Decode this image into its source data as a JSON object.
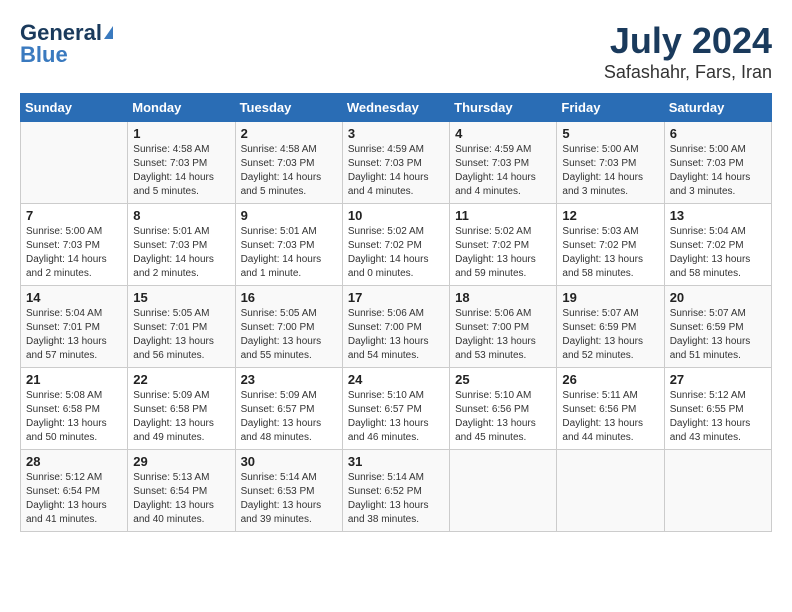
{
  "header": {
    "logo_general": "General",
    "logo_blue": "Blue",
    "title": "July 2024",
    "subtitle": "Safashahr, Fars, Iran"
  },
  "calendar": {
    "days_of_week": [
      "Sunday",
      "Monday",
      "Tuesday",
      "Wednesday",
      "Thursday",
      "Friday",
      "Saturday"
    ],
    "weeks": [
      [
        {
          "day": "",
          "info": ""
        },
        {
          "day": "1",
          "info": "Sunrise: 4:58 AM\nSunset: 7:03 PM\nDaylight: 14 hours\nand 5 minutes."
        },
        {
          "day": "2",
          "info": "Sunrise: 4:58 AM\nSunset: 7:03 PM\nDaylight: 14 hours\nand 5 minutes."
        },
        {
          "day": "3",
          "info": "Sunrise: 4:59 AM\nSunset: 7:03 PM\nDaylight: 14 hours\nand 4 minutes."
        },
        {
          "day": "4",
          "info": "Sunrise: 4:59 AM\nSunset: 7:03 PM\nDaylight: 14 hours\nand 4 minutes."
        },
        {
          "day": "5",
          "info": "Sunrise: 5:00 AM\nSunset: 7:03 PM\nDaylight: 14 hours\nand 3 minutes."
        },
        {
          "day": "6",
          "info": "Sunrise: 5:00 AM\nSunset: 7:03 PM\nDaylight: 14 hours\nand 3 minutes."
        }
      ],
      [
        {
          "day": "7",
          "info": ""
        },
        {
          "day": "8",
          "info": "Sunrise: 5:01 AM\nSunset: 7:03 PM\nDaylight: 14 hours\nand 2 minutes."
        },
        {
          "day": "9",
          "info": "Sunrise: 5:01 AM\nSunset: 7:03 PM\nDaylight: 14 hours\nand 1 minute."
        },
        {
          "day": "10",
          "info": "Sunrise: 5:02 AM\nSunset: 7:02 PM\nDaylight: 14 hours\nand 0 minutes."
        },
        {
          "day": "11",
          "info": "Sunrise: 5:02 AM\nSunset: 7:02 PM\nDaylight: 13 hours\nand 59 minutes."
        },
        {
          "day": "12",
          "info": "Sunrise: 5:03 AM\nSunset: 7:02 PM\nDaylight: 13 hours\nand 58 minutes."
        },
        {
          "day": "13",
          "info": "Sunrise: 5:04 AM\nSunset: 7:02 PM\nDaylight: 13 hours\nand 58 minutes."
        }
      ],
      [
        {
          "day": "14",
          "info": ""
        },
        {
          "day": "15",
          "info": "Sunrise: 5:05 AM\nSunset: 7:01 PM\nDaylight: 13 hours\nand 56 minutes."
        },
        {
          "day": "16",
          "info": "Sunrise: 5:05 AM\nSunset: 7:00 PM\nDaylight: 13 hours\nand 55 minutes."
        },
        {
          "day": "17",
          "info": "Sunrise: 5:06 AM\nSunset: 7:00 PM\nDaylight: 13 hours\nand 54 minutes."
        },
        {
          "day": "18",
          "info": "Sunrise: 5:06 AM\nSunset: 7:00 PM\nDaylight: 13 hours\nand 53 minutes."
        },
        {
          "day": "19",
          "info": "Sunrise: 5:07 AM\nSunset: 6:59 PM\nDaylight: 13 hours\nand 52 minutes."
        },
        {
          "day": "20",
          "info": "Sunrise: 5:07 AM\nSunset: 6:59 PM\nDaylight: 13 hours\nand 51 minutes."
        }
      ],
      [
        {
          "day": "21",
          "info": ""
        },
        {
          "day": "22",
          "info": "Sunrise: 5:09 AM\nSunset: 6:58 PM\nDaylight: 13 hours\nand 49 minutes."
        },
        {
          "day": "23",
          "info": "Sunrise: 5:09 AM\nSunset: 6:57 PM\nDaylight: 13 hours\nand 48 minutes."
        },
        {
          "day": "24",
          "info": "Sunrise: 5:10 AM\nSunset: 6:57 PM\nDaylight: 13 hours\nand 46 minutes."
        },
        {
          "day": "25",
          "info": "Sunrise: 5:10 AM\nSunset: 6:56 PM\nDaylight: 13 hours\nand 45 minutes."
        },
        {
          "day": "26",
          "info": "Sunrise: 5:11 AM\nSunset: 6:56 PM\nDaylight: 13 hours\nand 44 minutes."
        },
        {
          "day": "27",
          "info": "Sunrise: 5:12 AM\nSunset: 6:55 PM\nDaylight: 13 hours\nand 43 minutes."
        }
      ],
      [
        {
          "day": "28",
          "info": "Sunrise: 5:12 AM\nSunset: 6:54 PM\nDaylight: 13 hours\nand 41 minutes."
        },
        {
          "day": "29",
          "info": "Sunrise: 5:13 AM\nSunset: 6:54 PM\nDaylight: 13 hours\nand 40 minutes."
        },
        {
          "day": "30",
          "info": "Sunrise: 5:14 AM\nSunset: 6:53 PM\nDaylight: 13 hours\nand 39 minutes."
        },
        {
          "day": "31",
          "info": "Sunrise: 5:14 AM\nSunset: 6:52 PM\nDaylight: 13 hours\nand 38 minutes."
        },
        {
          "day": "",
          "info": ""
        },
        {
          "day": "",
          "info": ""
        },
        {
          "day": "",
          "info": ""
        }
      ]
    ],
    "week1_sunday_info": "Sunrise: 5:04 AM\nSunset: 7:01 PM\nDaylight: 13 hours\nand 57 minutes.",
    "week2_sunday_info": "Sunrise: 5:08 AM\nSunset: 6:58 PM\nDaylight: 13 hours\nand 50 minutes."
  }
}
